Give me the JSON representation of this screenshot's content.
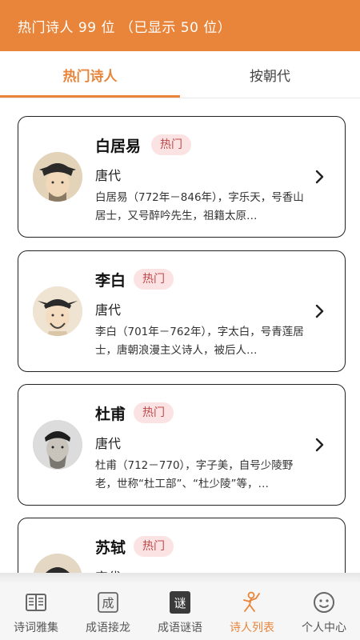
{
  "header": {
    "title": "热门诗人 99 位   （已显示 50 位）"
  },
  "tabs": [
    {
      "label": "热门诗人",
      "active": true
    },
    {
      "label": "按朝代",
      "active": false
    }
  ],
  "poets": [
    {
      "name": "白居易",
      "badge": "热门",
      "dynasty": "唐代",
      "desc": "白居易（772年－846年），字乐天，号香山居士，又号醉吟先生，祖籍太原…"
    },
    {
      "name": "李白",
      "badge": "热门",
      "dynasty": "唐代",
      "desc": "李白（701年－762年），字太白，号青莲居士，唐朝浪漫主义诗人，被后人…"
    },
    {
      "name": "杜甫",
      "badge": "热门",
      "dynasty": "唐代",
      "desc": "杜甫（712－770），字子美，自号少陵野老，世称“杜工部”、“杜少陵”等，…"
    },
    {
      "name": "苏轼",
      "badge": "热门",
      "dynasty": "宋代",
      "desc": ""
    }
  ],
  "nav": [
    {
      "label": "诗词雅集",
      "icon": "book-icon",
      "active": false
    },
    {
      "label": "成语接龙",
      "icon": "idiom-chain-icon",
      "active": false
    },
    {
      "label": "成语谜语",
      "icon": "idiom-riddle-icon",
      "active": false
    },
    {
      "label": "诗人列表",
      "icon": "poet-list-icon",
      "active": true
    },
    {
      "label": "个人中心",
      "icon": "profile-face-icon",
      "active": false
    }
  ],
  "colors": {
    "accent": "#e8853a",
    "badge_bg": "#fbe3e3",
    "badge_text": "#c0494a"
  }
}
